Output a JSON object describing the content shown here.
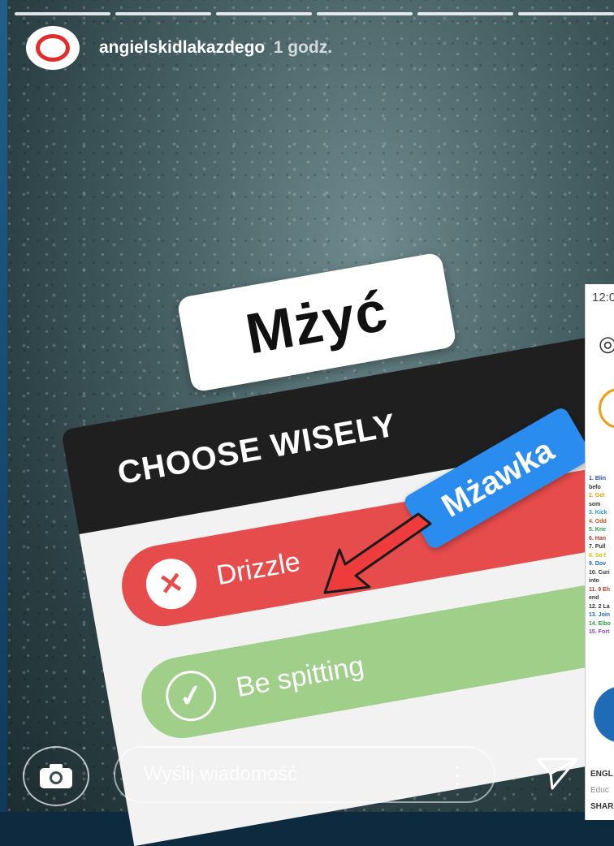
{
  "story": {
    "username": "angielskidlakazdego",
    "time": "1 godz.",
    "segments": 6
  },
  "stickers": {
    "word": "Mżyć",
    "translation": "Mżawka"
  },
  "poll": {
    "question": "CHOOSE WISELY",
    "options": [
      {
        "label": "Drizzle",
        "icon": "x-icon",
        "color": "#e74c4c"
      },
      {
        "label": "Be spitting",
        "icon": "check-icon",
        "color": "#9fcf89"
      }
    ]
  },
  "overlay": {
    "time": "12:0",
    "list": [
      "1. Blin",
      "befo",
      "2. Get",
      "som",
      "3. Kick",
      "4. Odd",
      "5. Kne",
      "6. Han",
      "7. Pull",
      "8. So f",
      "9. Dov",
      "10. Curi",
      "into",
      "11. 9 Eh",
      "end",
      "12. 2 La",
      "13. Join",
      "14. Elbo",
      "15. Fort"
    ],
    "footer": [
      "ENGL",
      "Educ",
      "SHAR"
    ]
  },
  "bottom": {
    "placeholder": "Wyślij wiadomość"
  },
  "colors": {
    "accent_red": "#e74c4c",
    "accent_green": "#9fcf89",
    "accent_blue": "#2b8cf0",
    "avatar_ring": "#e32b2b"
  }
}
